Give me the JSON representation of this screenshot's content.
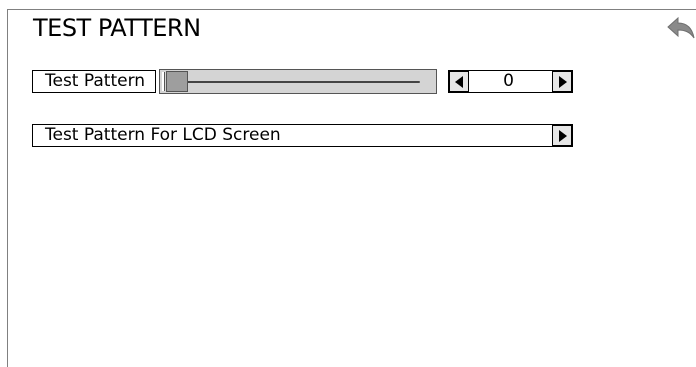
{
  "header": {
    "title": "TEST PATTERN",
    "back_icon": "back-arrow-icon"
  },
  "test_pattern_row": {
    "label": "Test Pattern",
    "slider_value_fraction": 0,
    "value": "0",
    "decrement_icon": "triangle-left-icon",
    "increment_icon": "triangle-right-icon"
  },
  "lcd_row": {
    "label": "Test Pattern For LCD Screen",
    "arrow_icon": "triangle-right-icon"
  },
  "colors": {
    "track": "#d4d4d4",
    "thumb": "#9e9e9e",
    "button": "#e6e6e6",
    "border": "#000000"
  }
}
